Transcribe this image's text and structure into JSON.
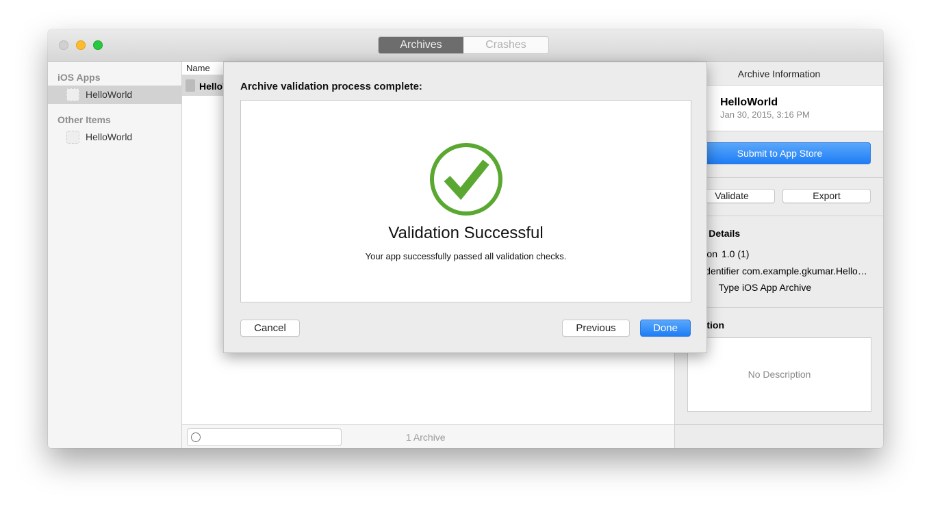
{
  "window": {
    "tabs": [
      {
        "label": "Archives",
        "selected": true
      },
      {
        "label": "Crashes",
        "selected": false
      }
    ]
  },
  "sidebar": {
    "sections": [
      {
        "title": "iOS Apps",
        "items": [
          {
            "label": "HelloWorld",
            "selected": true
          }
        ]
      },
      {
        "title": "Other Items",
        "items": [
          {
            "label": "HelloWorld",
            "selected": false
          }
        ]
      }
    ]
  },
  "list": {
    "column_name": "Name",
    "rows": [
      {
        "name": "HelloWorld"
      }
    ],
    "search_placeholder": "",
    "count": "1 Archive"
  },
  "info": {
    "header": "Archive Information",
    "app_name": "HelloWorld",
    "date": "Jan 30, 2015, 3:16 PM",
    "submit_label": "Submit to App Store",
    "validate_label": "Validate",
    "export_label": "Export",
    "details_title": "Archive Details",
    "version_label": "Version",
    "version": "1.0 (1)",
    "identifier_label": "Identifier",
    "identifier": "com.example.gkumar.Hello…",
    "type_label": "Type",
    "type": "iOS App Archive",
    "description_title": "Description",
    "description_placeholder": "No Description"
  },
  "dialog": {
    "title": "Archive validation process complete:",
    "status_icon": "checkmark-circle",
    "status_color": "#5aa832",
    "heading": "Validation Successful",
    "message": "Your app successfully passed all validation checks.",
    "cancel_label": "Cancel",
    "previous_label": "Previous",
    "done_label": "Done"
  }
}
